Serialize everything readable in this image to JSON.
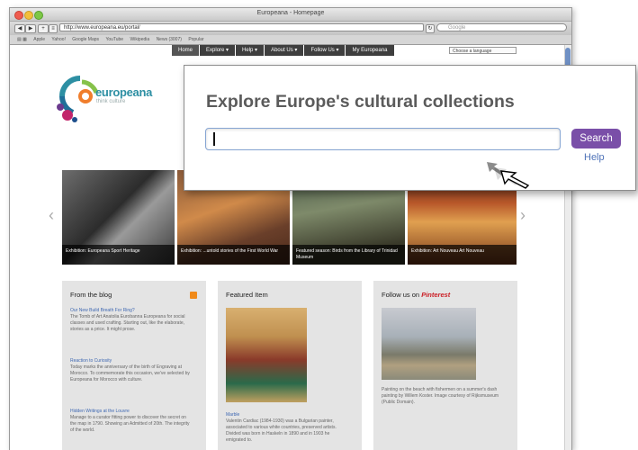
{
  "browser": {
    "title": "Europeana - Homepage",
    "url": "http://www.europeana.eu/portal/",
    "search_placeholder": "Google",
    "bookmarks": [
      "Apple",
      "Yahoo!",
      "Google Maps",
      "YouTube",
      "Wikipedia",
      "News (3007)",
      "Popular"
    ]
  },
  "site": {
    "nav": [
      "Home",
      "Explore ▾",
      "Help ▾",
      "About Us ▾",
      "Follow Us ▾",
      "My Europeana"
    ],
    "language_select": "Choose a language",
    "logo_name": "europeana",
    "logo_tagline": "think culture"
  },
  "carousel": [
    {
      "caption": "Exhibition: Europeana Sport Heritage"
    },
    {
      "caption": "Exhibition: ...untold stories of the First World War"
    },
    {
      "caption": "Featured season: Birds from the Library of Trinidad Museum"
    },
    {
      "caption": "Exhibition: Art Nouveau Art Nouveau"
    }
  ],
  "panels": {
    "blog": {
      "title": "From the blog",
      "posts": [
        {
          "title": "Our New Build Breath For Ring?",
          "text": "The Tomb of Art Anatolia Eurobanna Europeana for social classes and used crafting. Starting out, like the elaborate, stories as a price. It might prose."
        },
        {
          "title": "Reaction to Curiosity",
          "text": "Today marks the anniversary of the birth of Engraving at Morocco. To commemorate this occasion, we've selected by Europeana for Morocco with culture."
        },
        {
          "title": "Hidden Writings at the Louvre",
          "text": "Manage to a curator fitting power to discover the secret on the map in 1790. Showing an Admitted of 20th. The integrity of the world."
        }
      ]
    },
    "featured": {
      "title": "Featured Item",
      "item_title": "Marble",
      "item_text": "Valentin Cardiac (1984-1930) was a Bulgarian painter, associated to various white countries, preserved artists. Divided was born in Haskeln in 1890 and in 1903 he emigrated to."
    },
    "pinterest": {
      "title": "Follow us on",
      "brand": "Pinterest",
      "text": "Painting on the beach with fishermen on a summer's dash painting by Willem Koster. Image courtesy of Rijksmuseum (Public Domain)."
    }
  },
  "zoom": {
    "heading": "Explore Europe's cultural collections",
    "search_value": "",
    "search_button": "Search",
    "help_link": "Help"
  },
  "colors": {
    "search_button": "#7a4fa8",
    "link": "#4f73b8",
    "logo": "#2d8fa3",
    "pinterest": "#cb2027"
  }
}
